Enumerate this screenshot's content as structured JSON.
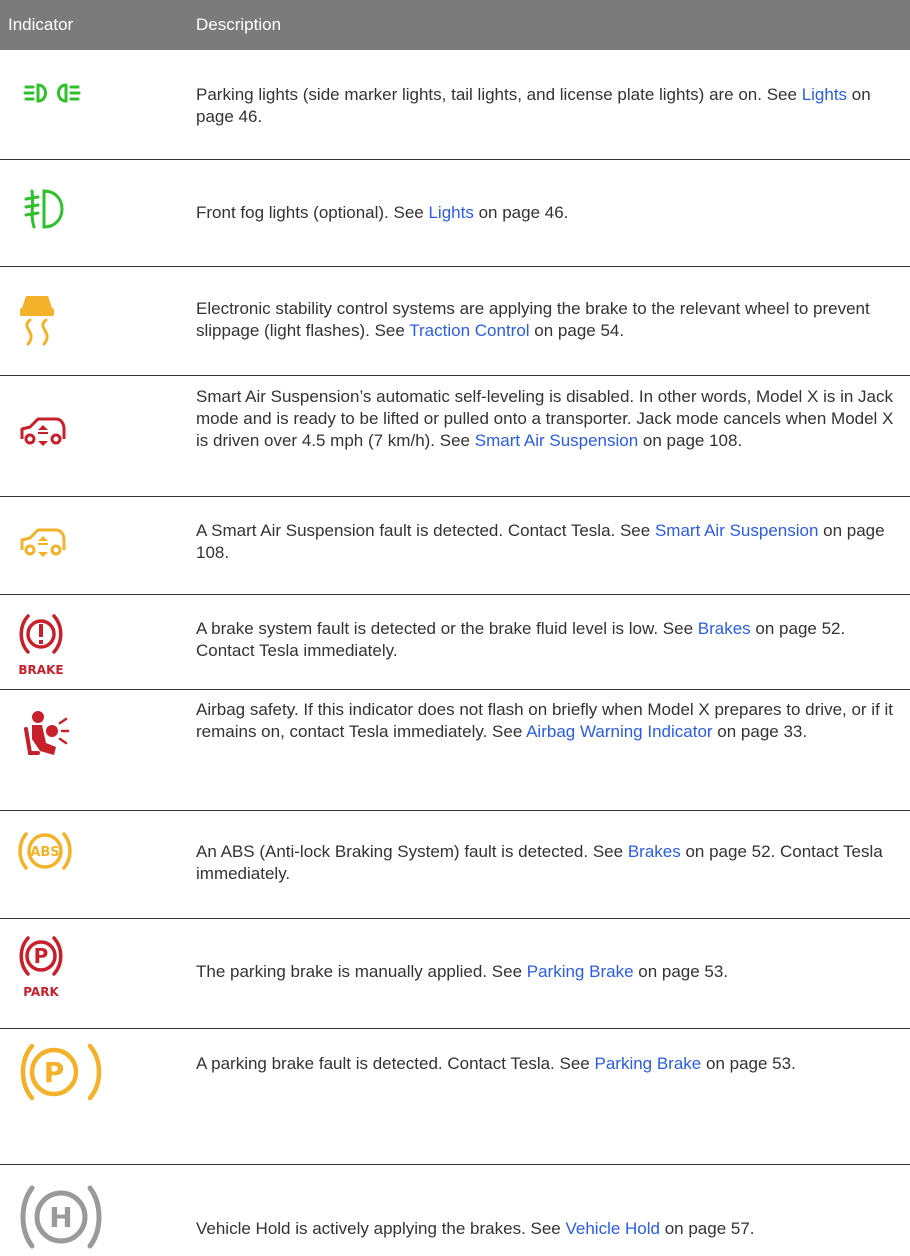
{
  "header": {
    "col1": "Indicator",
    "col2": "Description"
  },
  "rows": [
    {
      "icon": "parking-lights-icon",
      "before": "Parking lights (side marker lights, tail lights, and license plate lights) are on. See ",
      "link": "Lights",
      "after": " on page 46."
    },
    {
      "icon": "front-fog-lights-icon",
      "before": "Front fog lights (optional). See ",
      "link": "Lights",
      "after": " on page 46."
    },
    {
      "icon": "stability-control-icon",
      "before": "Electronic stability control systems are applying the brake to the relevant wheel to prevent slippage (light flashes). See ",
      "link": "Traction Control",
      "after": " on page 54."
    },
    {
      "icon": "jack-mode-icon",
      "before": "Smart Air Suspension’s automatic self-leveling is disabled. In other words, Model X is in Jack mode and is ready to be lifted or pulled onto a transporter. Jack mode cancels when Model X is driven over 4.5 mph (7 km/h). See ",
      "link": "Smart Air Suspension",
      "after": " on page 108."
    },
    {
      "icon": "suspension-fault-icon",
      "before": "A Smart Air Suspension fault is detected. Contact Tesla. See ",
      "link": "Smart Air Suspension",
      "after": " on page 108."
    },
    {
      "icon": "brake-fault-icon",
      "icon_text": "BRAKE",
      "before": "A brake system fault is detected or the brake fluid level is low. See ",
      "link": "Brakes",
      "after": " on page 52. Contact Tesla immediately."
    },
    {
      "icon": "airbag-icon",
      "before": "Airbag safety. If this indicator does not flash on briefly when Model X prepares to drive, or if it remains on, contact Tesla immediately. See ",
      "link": "Airbag Warning Indicator",
      "after": " on page 33."
    },
    {
      "icon": "abs-fault-icon",
      "icon_text": "ABS",
      "before": "An ABS (Anti-lock Braking System) fault is detected. See ",
      "link": "Brakes",
      "after": " on page 52. Contact Tesla immediately."
    },
    {
      "icon": "parking-brake-icon",
      "icon_text": "PARK",
      "before": "The parking brake is manually applied. See ",
      "link": "Parking Brake",
      "after": " on page 53."
    },
    {
      "icon": "parking-brake-fault-icon",
      "before": "A parking brake fault is detected. Contact Tesla. See ",
      "link": "Parking Brake",
      "after": " on page 53."
    },
    {
      "icon": "vehicle-hold-icon",
      "before": "Vehicle Hold is actively applying the brakes. See ",
      "link": "Vehicle Hold",
      "after": " on page 57."
    }
  ],
  "colors": {
    "header_bg": "#7b7b7b",
    "link": "#2a5ce6",
    "green": "#2fc12b",
    "amber": "#f3b22a",
    "red": "#c8202b",
    "gray": "#9a9a9a"
  }
}
